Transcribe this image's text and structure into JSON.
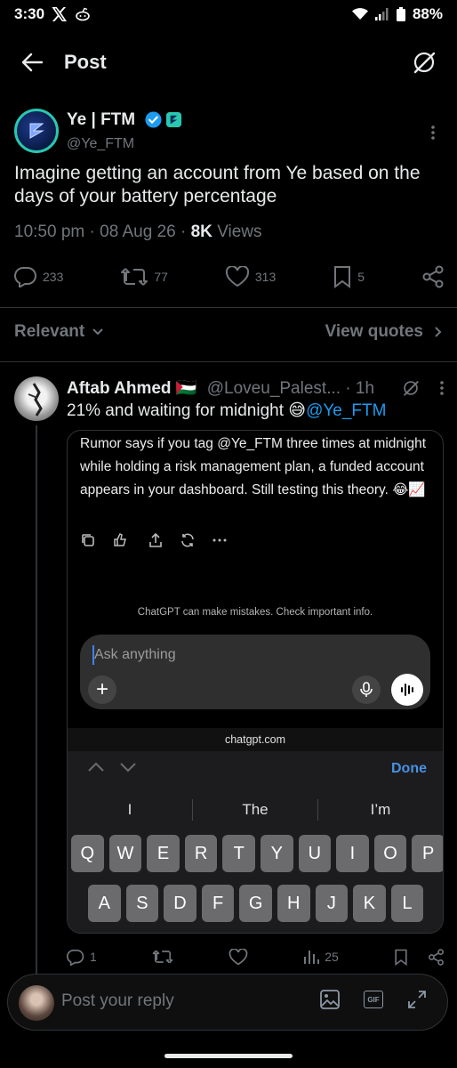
{
  "status_bar": {
    "time": "3:30",
    "battery": "88%"
  },
  "header": {
    "title": "Post"
  },
  "post": {
    "author_name": "Ye | FTM",
    "author_handle": "@Ye_FTM",
    "text": "Imagine getting an account from Ye based on the days of your battery percentage",
    "time": "10:50 pm",
    "date": "08 Aug 26",
    "views_count": "8K",
    "views_label": "Views",
    "replies": "233",
    "reposts": "77",
    "likes": "313",
    "bookmarks": "5"
  },
  "sort": {
    "relevant": "Relevant",
    "view_quotes": "View quotes"
  },
  "reply": {
    "author_name": "Aftab Ahmed",
    "flag": "🇵🇸",
    "author_handle": "@Loveu_Palest...",
    "time": "1h",
    "text": "21% and waiting for midnight 😅",
    "mention": "@Ye_FTM",
    "replies": "1",
    "views": "25"
  },
  "embed": {
    "gpt_text": "Rumor says if you tag @Ye_FTM three times at midnight while holding a risk management plan, a funded account appears in your dashboard. Still testing this theory. 😂📈",
    "disclaimer": "ChatGPT can make mistakes. Check important info.",
    "input_placeholder": "Ask anything",
    "url": "chatgpt.com",
    "done": "Done",
    "suggestions": [
      "I",
      "The",
      "I’m"
    ],
    "keyboard_row1": [
      "Q",
      "W",
      "E",
      "R",
      "T",
      "Y",
      "U",
      "I",
      "O",
      "P"
    ],
    "keyboard_row2": [
      "A",
      "S",
      "D",
      "F",
      "G",
      "H",
      "J",
      "K",
      "L"
    ]
  },
  "composer": {
    "placeholder": "Post your reply"
  },
  "colors": {
    "accent": "#1d9bf0",
    "muted": "#71767b",
    "verified": "#1d9bf0",
    "affiliate": "#29c7b0"
  }
}
